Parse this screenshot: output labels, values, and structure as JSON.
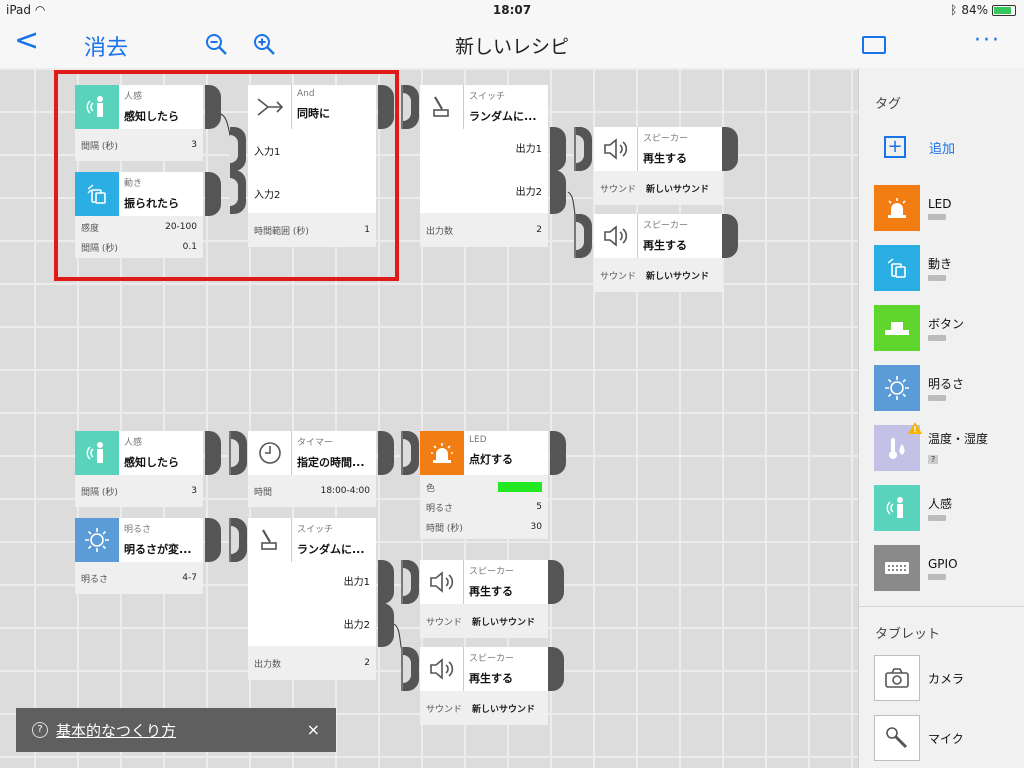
{
  "status": {
    "device": "iPad",
    "time": "18:07",
    "battery": "84%",
    "battery_level": 0.84
  },
  "nav": {
    "back": "<",
    "clear": "消去",
    "title": "新しいレシピ",
    "more": "···"
  },
  "blocks": {
    "motion1": {
      "cat": "人感",
      "name": "感知したら",
      "props": [
        {
          "k": "間隔 (秒)",
          "v": "3"
        }
      ]
    },
    "shake": {
      "cat": "動き",
      "name": "振られたら",
      "props": [
        {
          "k": "感度",
          "v": "20-100"
        },
        {
          "k": "間隔 (秒)",
          "v": "0.1"
        }
      ]
    },
    "and": {
      "cat": "And",
      "name": "同時に",
      "in1": "入力1",
      "in2": "入力2",
      "props": [
        {
          "k": "時間範囲 (秒)",
          "v": "1"
        }
      ]
    },
    "switch1": {
      "cat": "スイッチ",
      "name": "ランダムに...",
      "out1": "出力1",
      "out2": "出力2",
      "props": [
        {
          "k": "出力数",
          "v": "2"
        }
      ]
    },
    "speaker1": {
      "cat": "スピーカー",
      "name": "再生する",
      "props": [
        {
          "k": "サウンド",
          "v": "新しいサウンド"
        }
      ]
    },
    "speaker2": {
      "cat": "スピーカー",
      "name": "再生する",
      "props": [
        {
          "k": "サウンド",
          "v": "新しいサウンド"
        }
      ]
    },
    "motion2": {
      "cat": "人感",
      "name": "感知したら",
      "props": [
        {
          "k": "間隔 (秒)",
          "v": "3"
        }
      ]
    },
    "timer": {
      "cat": "タイマー",
      "name": "指定の時間...",
      "props": [
        {
          "k": "時間",
          "v": "18:00-4:00"
        }
      ]
    },
    "led": {
      "cat": "LED",
      "name": "点灯する",
      "color_label": "色",
      "color": "#22e822",
      "props": [
        {
          "k": "明るさ",
          "v": "5"
        },
        {
          "k": "時間 (秒)",
          "v": "30"
        }
      ]
    },
    "bright": {
      "cat": "明るさ",
      "name": "明るさが変...",
      "props": [
        {
          "k": "明るさ",
          "v": "4-7"
        }
      ]
    },
    "switch2": {
      "cat": "スイッチ",
      "name": "ランダムに...",
      "out1": "出力1",
      "out2": "出力2",
      "props": [
        {
          "k": "出力数",
          "v": "2"
        }
      ]
    },
    "speaker3": {
      "cat": "スピーカー",
      "name": "再生する",
      "props": [
        {
          "k": "サウンド",
          "v": "新しいサウンド"
        }
      ]
    },
    "speaker4": {
      "cat": "スピーカー",
      "name": "再生する",
      "props": [
        {
          "k": "サウンド",
          "v": "新しいサウンド"
        }
      ]
    }
  },
  "toast": {
    "q": "?",
    "text": "基本的なつくり方",
    "close": "×"
  },
  "sidebar": {
    "tags_title": "タグ",
    "add_label": "追加",
    "items": [
      {
        "label": "LED",
        "color": "#f27d13"
      },
      {
        "label": "動き",
        "color": "#2aaee3"
      },
      {
        "label": "ボタン",
        "color": "#5ed62e"
      },
      {
        "label": "明るさ",
        "color": "#5b9bd8"
      },
      {
        "label": "温度・湿度",
        "color": "#c4c1e6",
        "badge": "?"
      },
      {
        "label": "人感",
        "color": "#59d3bb"
      },
      {
        "label": "GPIO",
        "color": "#8a8a8a"
      }
    ],
    "tablet_title": "タブレット",
    "tablet_items": [
      {
        "label": "カメラ"
      },
      {
        "label": "マイク"
      }
    ]
  },
  "colors": {
    "accent": "#1a73e8",
    "highlight": "#e01919"
  }
}
